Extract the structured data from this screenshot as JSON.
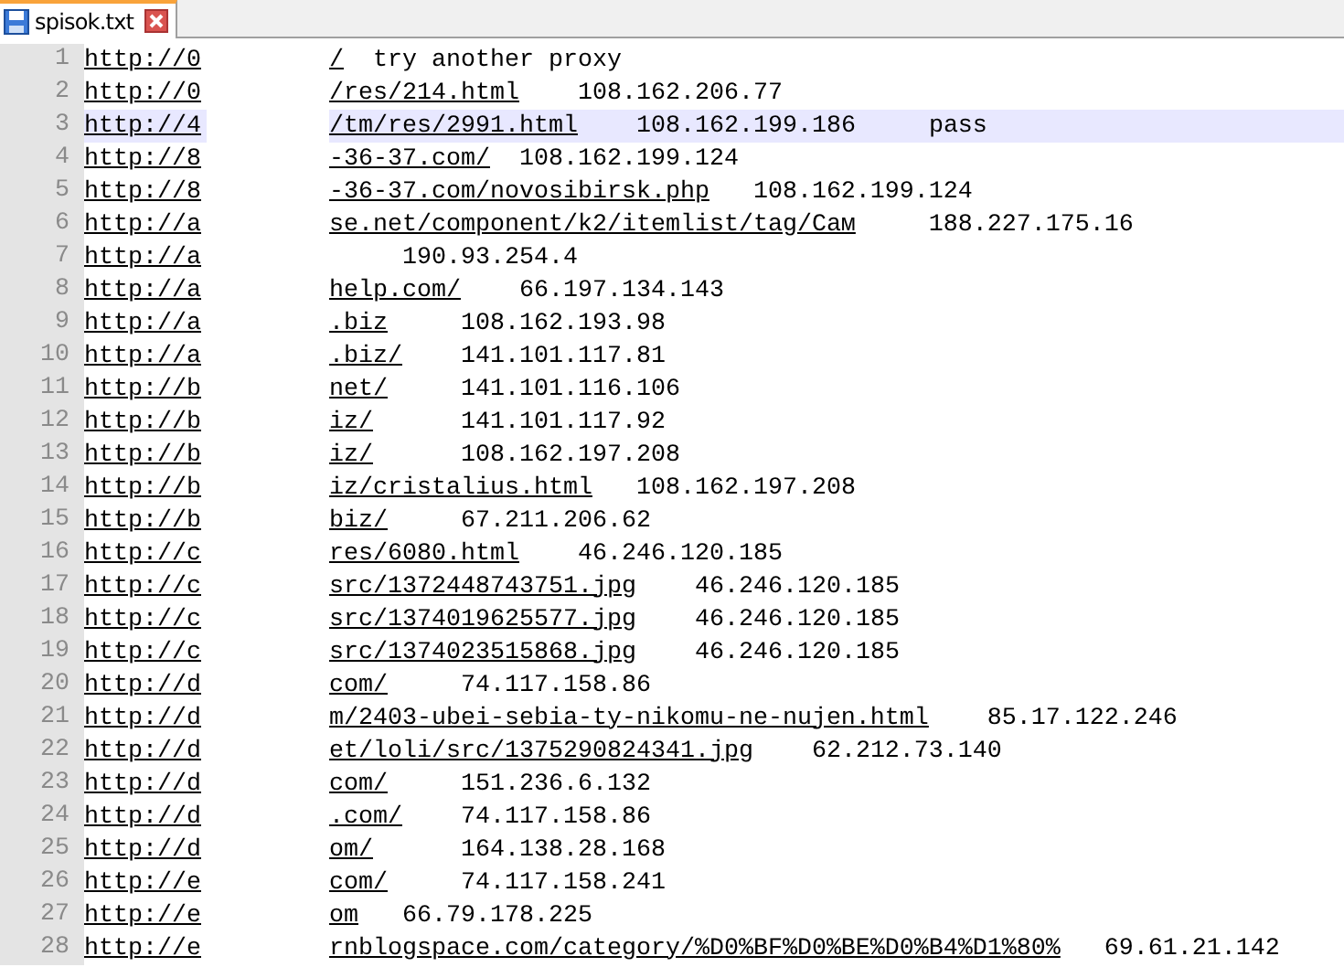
{
  "tabs": [
    {
      "label": "spisok.txt",
      "selected": true
    }
  ],
  "lines": [
    {
      "number": "1",
      "link_start": "http://0",
      "link_end": "/",
      "tail": "  try another proxy",
      "current": false
    },
    {
      "number": "2",
      "link_start": "http://0",
      "link_end": "/res/214.html",
      "tail": "    108.162.206.77",
      "current": false
    },
    {
      "number": "3",
      "link_start": "http://4",
      "link_end": "/tm/res/2991.html",
      "tail": "    108.162.199.186     pass",
      "current": true
    },
    {
      "number": "4",
      "link_start": "http://8",
      "link_end": "-36-37.com/",
      "tail": "  108.162.199.124",
      "current": false
    },
    {
      "number": "5",
      "link_start": "http://8",
      "link_end": "-36-37.com/novosibirsk.php",
      "tail": "   108.162.199.124",
      "current": false
    },
    {
      "number": "6",
      "link_start": "http://a",
      "link_end": "se.net/component/k2/itemlist/tag/Сам",
      "tail": "     188.227.175.16",
      "current": false
    },
    {
      "number": "7",
      "link_start": "http://a",
      "tail": "     190.93.254.4",
      "current": false
    },
    {
      "number": "8",
      "link_start": "http://a",
      "link_end": "help.com/",
      "tail": "    66.197.134.143",
      "current": false
    },
    {
      "number": "9",
      "link_start": "http://a",
      "link_end": ".biz",
      "tail": "     108.162.193.98",
      "current": false
    },
    {
      "number": "10",
      "link_start": "http://a",
      "link_end": ".biz/",
      "tail": "    141.101.117.81",
      "current": false
    },
    {
      "number": "11",
      "link_start": "http://b",
      "link_end": "net/",
      "tail": "     141.101.116.106",
      "current": false
    },
    {
      "number": "12",
      "link_start": "http://b",
      "link_end": "iz/",
      "tail": "      141.101.117.92",
      "current": false
    },
    {
      "number": "13",
      "link_start": "http://b",
      "link_end": "iz/",
      "tail": "      108.162.197.208",
      "current": false
    },
    {
      "number": "14",
      "link_start": "http://b",
      "link_end": "iz/cristalius.html",
      "tail": "   108.162.197.208",
      "current": false
    },
    {
      "number": "15",
      "link_start": "http://b",
      "link_end": "biz/",
      "tail": "     67.211.206.62",
      "current": false
    },
    {
      "number": "16",
      "link_start": "http://c",
      "link_end": "res/6080.html",
      "tail": "    46.246.120.185",
      "current": false
    },
    {
      "number": "17",
      "link_start": "http://c",
      "link_end": "src/1372448743751.jpg",
      "tail": "    46.246.120.185",
      "current": false
    },
    {
      "number": "18",
      "link_start": "http://c",
      "link_end": "src/1374019625577.jpg",
      "tail": "    46.246.120.185",
      "current": false
    },
    {
      "number": "19",
      "link_start": "http://c",
      "link_end": "src/1374023515868.jpg",
      "tail": "    46.246.120.185",
      "current": false
    },
    {
      "number": "20",
      "link_start": "http://d",
      "link_end": "com/",
      "tail": "     74.117.158.86",
      "current": false
    },
    {
      "number": "21",
      "link_start": "http://d",
      "link_end": "m/2403-ubei-sebia-ty-nikomu-ne-nujen.html",
      "tail": "    85.17.122.246",
      "current": false
    },
    {
      "number": "22",
      "link_start": "http://d",
      "link_end": "et/loli/src/1375290824341.jpg",
      "tail": "    62.212.73.140",
      "current": false
    },
    {
      "number": "23",
      "link_start": "http://d",
      "link_end": "com/",
      "tail": "     151.236.6.132",
      "current": false
    },
    {
      "number": "24",
      "link_start": "http://d",
      "link_end": ".com/",
      "tail": "    74.117.158.86",
      "current": false
    },
    {
      "number": "25",
      "link_start": "http://d",
      "link_end": "om/",
      "tail": "      164.138.28.168",
      "current": false
    },
    {
      "number": "26",
      "link_start": "http://e",
      "link_end": "com/",
      "tail": "     74.117.158.241",
      "current": false
    },
    {
      "number": "27",
      "link_start": "http://e",
      "link_end": "om",
      "tail": "   66.79.178.225",
      "current": false
    },
    {
      "number": "28",
      "link_start": "http://e",
      "link_end": "rnblogspace.com/category/%D0%BF%D0%BE%D0%B4%D1%80%",
      "tail": "   69.61.21.142",
      "current": false
    }
  ]
}
